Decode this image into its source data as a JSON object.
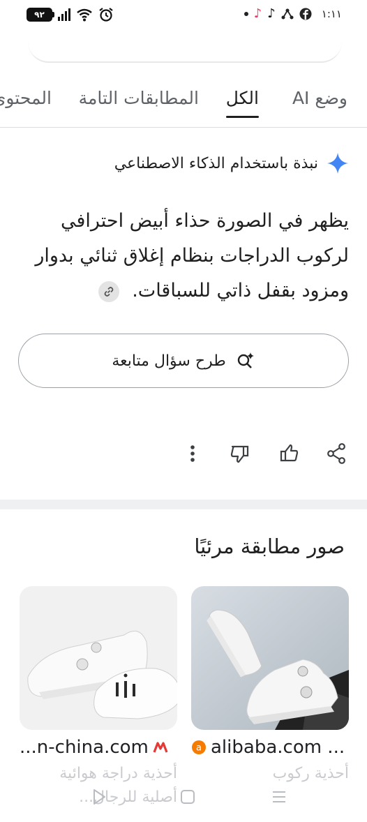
{
  "status_bar": {
    "battery": "٩٢",
    "time": "١:١١",
    "icons": [
      "signal-icon",
      "wifi-icon",
      "alarm-icon",
      "tiktok-lite-icon",
      "tiktok-icon",
      "network-icon",
      "facebook-icon"
    ]
  },
  "tabs": [
    {
      "label": "وضع AI",
      "active": false
    },
    {
      "label": "الكل",
      "active": true
    },
    {
      "label": "المطابقات التامة",
      "active": false
    },
    {
      "label": "المحتوى",
      "active": false
    }
  ],
  "ai_overview": {
    "title": "نبذة باستخدام الذكاء الاصطناعي",
    "body": "يظهر في الصورة حذاء أبيض احترافي لركوب الدراجات بنظام إغلاق ثنائي بدوار ومزود بقفل ذاتي للسباقات.",
    "followup_label": "طرح سؤال متابعة",
    "accent_color": "#4285f4"
  },
  "visual_matches": {
    "title": "صور مطابقة مرئيًا",
    "items": [
      {
        "source": "alibaba.com ...",
        "description": "أحذية ركوب",
        "favicon_color": "#f57c00"
      },
      {
        "source": "...n-china.com",
        "description": "أحذية دراجة هوائية أصلية للرجال...",
        "favicon_color": "#e53935"
      }
    ]
  }
}
